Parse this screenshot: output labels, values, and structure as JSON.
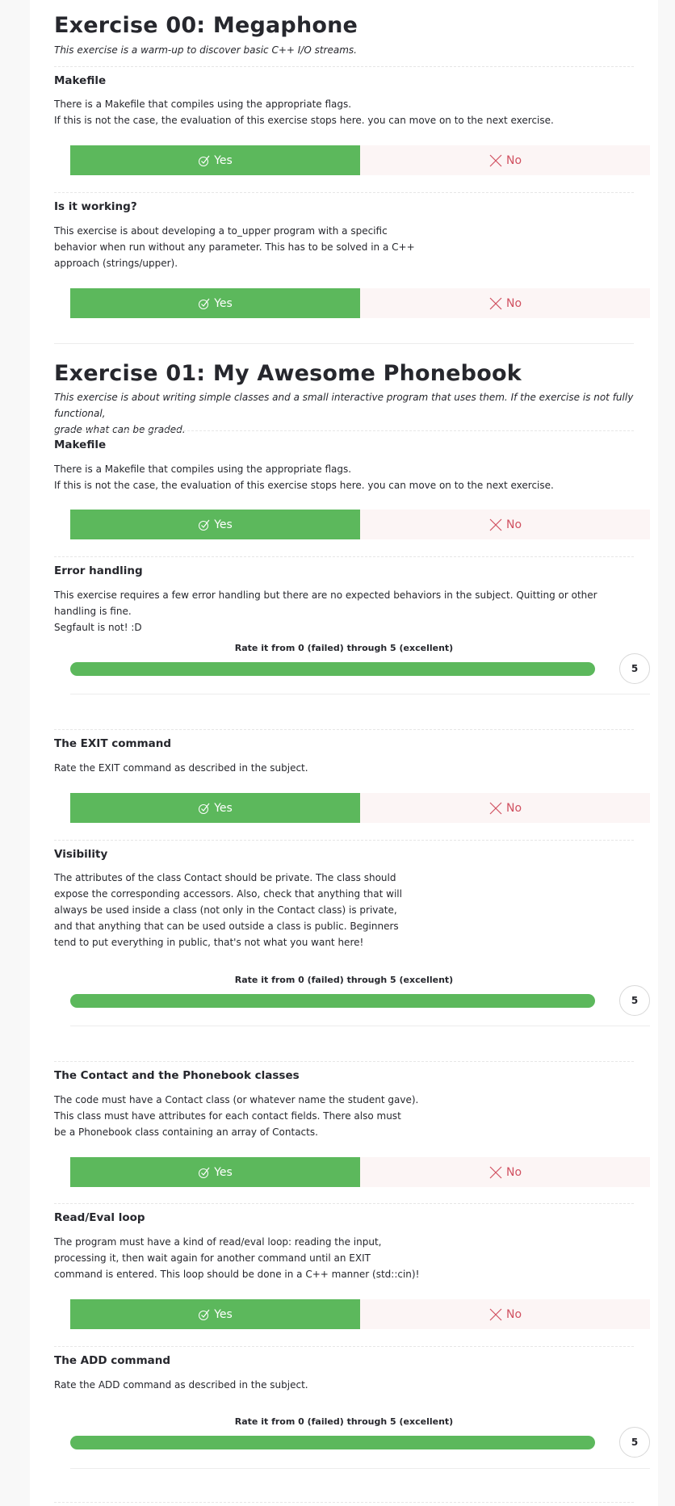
{
  "exercises": [
    {
      "title": "Exercise 00: Megaphone",
      "description": "This exercise is a warm-up to discover basic C++ I/O streams.",
      "sections": [
        {
          "title": "Makefile",
          "lines": [
            "There is a Makefile that compiles using the appropriate flags.",
            "If this is not the case, the evaluation of this exercise stops here. you can move on to the next exercise."
          ]
        },
        {
          "title": "Is it working?",
          "lines": [
            "This exercise is about developing a to_upper program with a specific",
            "behavior when run without any parameter. This has to be solved in a C++",
            "approach (strings/upper)."
          ]
        }
      ]
    },
    {
      "title": "Exercise 01: My Awesome Phonebook",
      "description_lines": [
        "This exercise is about writing simple classes and a small interactive program that uses them. If the exercise is not fully functional,",
        "grade what can be graded."
      ],
      "sections": [
        {
          "title": "Makefile",
          "lines": [
            "There is a Makefile that compiles using the appropriate flags.",
            "If this is not the case, the evaluation of this exercise stops here. you can move on to the next exercise."
          ]
        },
        {
          "title": "Error handling",
          "lines": [
            "This exercise requires a few error handling but there are no expected behaviors in the subject. Quitting or other handling is fine.",
            "Segfault is not! :D"
          ],
          "rating": 5
        },
        {
          "title": "The EXIT command",
          "lines": [
            "Rate the EXIT command as described in the subject."
          ]
        },
        {
          "title": "Visibility",
          "lines": [
            "The attributes of the class Contact should be private. The class should",
            "expose the corresponding accessors. Also, check that anything that will",
            "always be used inside a class (not only in the Contact class) is private,",
            "and that anything that can be used outside a class is public. Beginners",
            "tend to put everything in public, that's not what you want here!"
          ],
          "rating": 5
        },
        {
          "title": "The Contact and the Phonebook classes",
          "lines": [
            "The code must have a Contact class (or whatever name the student gave).",
            "This class must have attributes for each contact fields. There also must",
            "be a Phonebook class containing an array of Contacts."
          ]
        },
        {
          "title": "Read/Eval loop",
          "lines": [
            "The program must have a kind of read/eval loop: reading the input,",
            "processing it, then wait again for another command until an EXIT",
            "command is entered. This loop should be done in a C++ manner (std::cin)!"
          ]
        },
        {
          "title": "The ADD command",
          "lines": [
            "Rate the ADD command as described in the subject."
          ],
          "rating": 5
        }
      ]
    }
  ],
  "buttons": {
    "yes": "Yes",
    "no": "No"
  },
  "rate_label": "Rate it from 0 (failed) through 5 (excellent)",
  "colors": {
    "yes_bg": "#5cb85c",
    "no_bg": "#fcf5f5",
    "no_text": "#d05060"
  }
}
